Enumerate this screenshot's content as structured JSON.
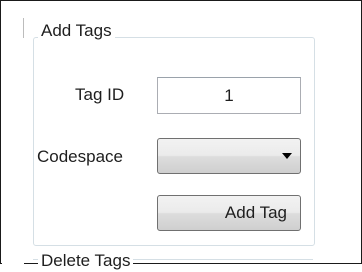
{
  "add_tags_group": {
    "title": "Add Tags",
    "tag_id_label": "Tag ID",
    "tag_id_value": "1",
    "codespace_label": "Codespace",
    "codespace_selected": "",
    "add_button_label": "Add Tag"
  },
  "delete_tags_group": {
    "title": "Delete Tags"
  },
  "icons": {
    "combo_arrow": "chevron-down-icon"
  }
}
